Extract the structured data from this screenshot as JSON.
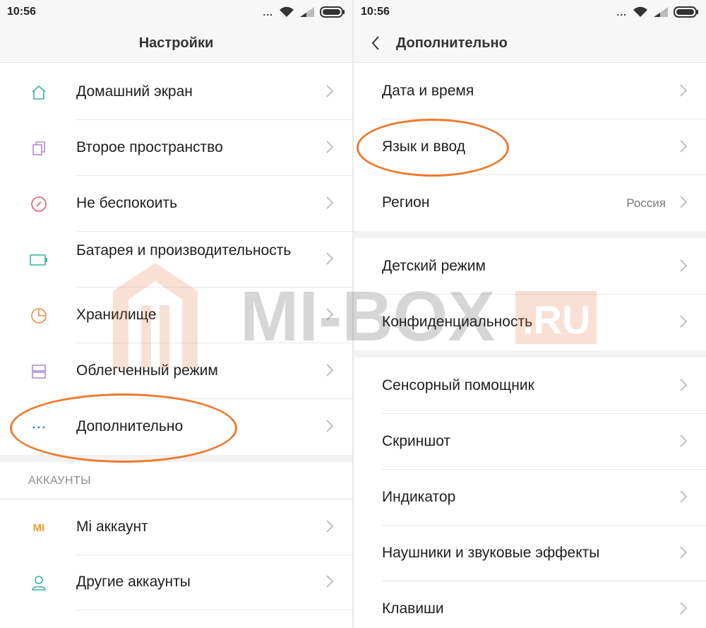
{
  "left": {
    "status": {
      "time": "10:56",
      "dots": "..."
    },
    "title": "Настройки",
    "items": [
      {
        "label": "Домашний экран",
        "icon": "home-icon"
      },
      {
        "label": "Второе пространство",
        "icon": "second-space-icon"
      },
      {
        "label": "Не беспокоить",
        "icon": "do-not-disturb-icon"
      },
      {
        "label": "Батарея и производительность",
        "icon": "battery-icon"
      },
      {
        "label": "Хранилище",
        "icon": "storage-icon"
      },
      {
        "label": "Облегченный режим",
        "icon": "lite-mode-icon"
      },
      {
        "label": "Дополнительно",
        "icon": "more-icon"
      }
    ],
    "accounts_header": "АККАУНТЫ",
    "accounts": [
      {
        "label": "Mi аккаунт",
        "icon": "mi-account-icon",
        "icon_text": "MI"
      },
      {
        "label": "Другие аккаунты",
        "icon": "user-icon"
      }
    ]
  },
  "right": {
    "status": {
      "time": "10:56",
      "dots": "..."
    },
    "title": "Дополнительно",
    "items": [
      {
        "label": "Дата и время"
      },
      {
        "label": "Язык и ввод"
      },
      {
        "label": "Регион",
        "value": "Россия"
      },
      {
        "label": "Детский режим"
      },
      {
        "label": "Конфиденциальность"
      },
      {
        "label": "Сенсорный помощник"
      },
      {
        "label": "Скриншот"
      },
      {
        "label": "Индикатор"
      },
      {
        "label": "Наушники и звуковые эффекты"
      },
      {
        "label": "Клавиши"
      }
    ]
  },
  "watermark": {
    "text": "MI-BOX",
    "suffix": ".RU"
  },
  "colors": {
    "accent_orange": "#ee7a2f",
    "icon_teal": "#3ab09e",
    "icon_purple": "#b58bd6",
    "icon_red": "#e05a6a",
    "icon_orange": "#f08a4b",
    "icon_blue": "#3a8fd8",
    "mi_orange": "#f39c1f"
  }
}
